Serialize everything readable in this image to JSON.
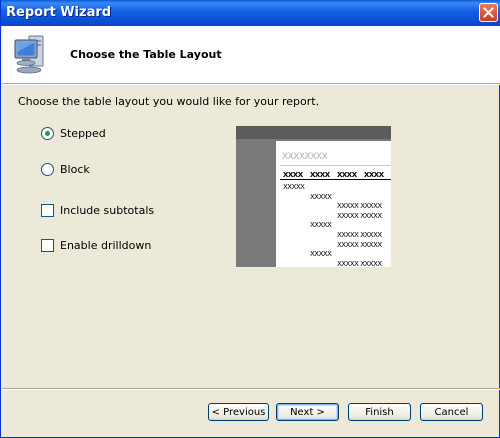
{
  "window": {
    "title": "Report Wizard"
  },
  "header": {
    "title": "Choose the Table Layout",
    "icon": "computer-icon"
  },
  "instruction": "Choose the table layout you would like for your report.",
  "layout_options": [
    {
      "label": "Stepped",
      "selected": true
    },
    {
      "label": "Block",
      "selected": false
    }
  ],
  "checkboxes": [
    {
      "label": "Include subtotals",
      "checked": false
    },
    {
      "label": "Enable drilldown",
      "checked": false
    }
  ],
  "preview": {
    "title": "XXXXXXXX",
    "headers": [
      "XXXX",
      "XXXX",
      "XXXX",
      "XXXX"
    ],
    "rows": [
      {
        "text": "XXXXX",
        "level": 0
      },
      {
        "text": "XXXXX",
        "level": 1
      },
      {
        "text": "XXXXX  XXXXX",
        "level": 2
      },
      {
        "text": "XXXXX  XXXXX",
        "level": 2
      },
      {
        "text": "XXXXX",
        "level": 1
      },
      {
        "text": "XXXXX  XXXXX",
        "level": 2
      },
      {
        "text": "XXXXX  XXXXX",
        "level": 2
      },
      {
        "text": "XXXXX",
        "level": 1
      },
      {
        "text": "XXXXX  XXXXX",
        "level": 2
      }
    ]
  },
  "buttons": {
    "previous": "< Previous",
    "next": "Next >",
    "finish": "Finish",
    "cancel": "Cancel"
  },
  "colors": {
    "titlebar": "#0a5ce0",
    "radio_dot": "#21a121",
    "background": "#ece9d8"
  }
}
